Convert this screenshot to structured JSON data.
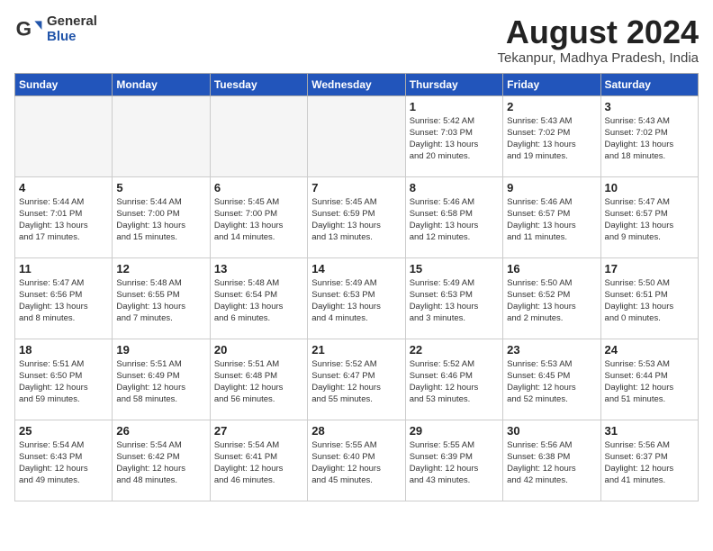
{
  "logo": {
    "general": "General",
    "blue": "Blue"
  },
  "title": "August 2024",
  "location": "Tekanpur, Madhya Pradesh, India",
  "days_of_week": [
    "Sunday",
    "Monday",
    "Tuesday",
    "Wednesday",
    "Thursday",
    "Friday",
    "Saturday"
  ],
  "weeks": [
    [
      {
        "day": "",
        "info": ""
      },
      {
        "day": "",
        "info": ""
      },
      {
        "day": "",
        "info": ""
      },
      {
        "day": "",
        "info": ""
      },
      {
        "day": "1",
        "info": "Sunrise: 5:42 AM\nSunset: 7:03 PM\nDaylight: 13 hours\nand 20 minutes."
      },
      {
        "day": "2",
        "info": "Sunrise: 5:43 AM\nSunset: 7:02 PM\nDaylight: 13 hours\nand 19 minutes."
      },
      {
        "day": "3",
        "info": "Sunrise: 5:43 AM\nSunset: 7:02 PM\nDaylight: 13 hours\nand 18 minutes."
      }
    ],
    [
      {
        "day": "4",
        "info": "Sunrise: 5:44 AM\nSunset: 7:01 PM\nDaylight: 13 hours\nand 17 minutes."
      },
      {
        "day": "5",
        "info": "Sunrise: 5:44 AM\nSunset: 7:00 PM\nDaylight: 13 hours\nand 15 minutes."
      },
      {
        "day": "6",
        "info": "Sunrise: 5:45 AM\nSunset: 7:00 PM\nDaylight: 13 hours\nand 14 minutes."
      },
      {
        "day": "7",
        "info": "Sunrise: 5:45 AM\nSunset: 6:59 PM\nDaylight: 13 hours\nand 13 minutes."
      },
      {
        "day": "8",
        "info": "Sunrise: 5:46 AM\nSunset: 6:58 PM\nDaylight: 13 hours\nand 12 minutes."
      },
      {
        "day": "9",
        "info": "Sunrise: 5:46 AM\nSunset: 6:57 PM\nDaylight: 13 hours\nand 11 minutes."
      },
      {
        "day": "10",
        "info": "Sunrise: 5:47 AM\nSunset: 6:57 PM\nDaylight: 13 hours\nand 9 minutes."
      }
    ],
    [
      {
        "day": "11",
        "info": "Sunrise: 5:47 AM\nSunset: 6:56 PM\nDaylight: 13 hours\nand 8 minutes."
      },
      {
        "day": "12",
        "info": "Sunrise: 5:48 AM\nSunset: 6:55 PM\nDaylight: 13 hours\nand 7 minutes."
      },
      {
        "day": "13",
        "info": "Sunrise: 5:48 AM\nSunset: 6:54 PM\nDaylight: 13 hours\nand 6 minutes."
      },
      {
        "day": "14",
        "info": "Sunrise: 5:49 AM\nSunset: 6:53 PM\nDaylight: 13 hours\nand 4 minutes."
      },
      {
        "day": "15",
        "info": "Sunrise: 5:49 AM\nSunset: 6:53 PM\nDaylight: 13 hours\nand 3 minutes."
      },
      {
        "day": "16",
        "info": "Sunrise: 5:50 AM\nSunset: 6:52 PM\nDaylight: 13 hours\nand 2 minutes."
      },
      {
        "day": "17",
        "info": "Sunrise: 5:50 AM\nSunset: 6:51 PM\nDaylight: 13 hours\nand 0 minutes."
      }
    ],
    [
      {
        "day": "18",
        "info": "Sunrise: 5:51 AM\nSunset: 6:50 PM\nDaylight: 12 hours\nand 59 minutes."
      },
      {
        "day": "19",
        "info": "Sunrise: 5:51 AM\nSunset: 6:49 PM\nDaylight: 12 hours\nand 58 minutes."
      },
      {
        "day": "20",
        "info": "Sunrise: 5:51 AM\nSunset: 6:48 PM\nDaylight: 12 hours\nand 56 minutes."
      },
      {
        "day": "21",
        "info": "Sunrise: 5:52 AM\nSunset: 6:47 PM\nDaylight: 12 hours\nand 55 minutes."
      },
      {
        "day": "22",
        "info": "Sunrise: 5:52 AM\nSunset: 6:46 PM\nDaylight: 12 hours\nand 53 minutes."
      },
      {
        "day": "23",
        "info": "Sunrise: 5:53 AM\nSunset: 6:45 PM\nDaylight: 12 hours\nand 52 minutes."
      },
      {
        "day": "24",
        "info": "Sunrise: 5:53 AM\nSunset: 6:44 PM\nDaylight: 12 hours\nand 51 minutes."
      }
    ],
    [
      {
        "day": "25",
        "info": "Sunrise: 5:54 AM\nSunset: 6:43 PM\nDaylight: 12 hours\nand 49 minutes."
      },
      {
        "day": "26",
        "info": "Sunrise: 5:54 AM\nSunset: 6:42 PM\nDaylight: 12 hours\nand 48 minutes."
      },
      {
        "day": "27",
        "info": "Sunrise: 5:54 AM\nSunset: 6:41 PM\nDaylight: 12 hours\nand 46 minutes."
      },
      {
        "day": "28",
        "info": "Sunrise: 5:55 AM\nSunset: 6:40 PM\nDaylight: 12 hours\nand 45 minutes."
      },
      {
        "day": "29",
        "info": "Sunrise: 5:55 AM\nSunset: 6:39 PM\nDaylight: 12 hours\nand 43 minutes."
      },
      {
        "day": "30",
        "info": "Sunrise: 5:56 AM\nSunset: 6:38 PM\nDaylight: 12 hours\nand 42 minutes."
      },
      {
        "day": "31",
        "info": "Sunrise: 5:56 AM\nSunset: 6:37 PM\nDaylight: 12 hours\nand 41 minutes."
      }
    ]
  ]
}
